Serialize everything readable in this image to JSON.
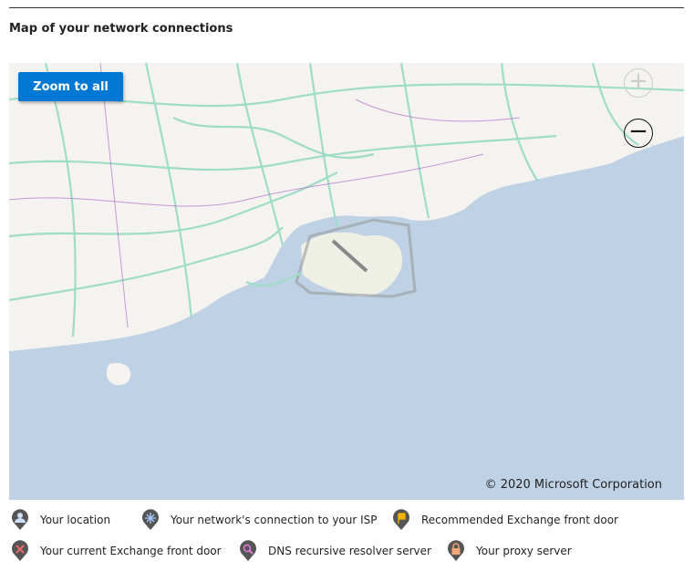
{
  "title": "Map of your network connections",
  "map": {
    "zoom_all_label": "Zoom to all",
    "zoom_in": "+",
    "zoom_out": "−",
    "copyright": "© 2020 Microsoft Corporation",
    "colors": {
      "sea": "#bfd1e5",
      "land": "#f5f3f0",
      "roads": "#9fdcc8",
      "accent": "#0078d4"
    }
  },
  "legend": [
    {
      "label": "Your location",
      "icon": "person-icon",
      "color": "#cfe0ff"
    },
    {
      "label": "Your network's connection to your ISP",
      "icon": "network-icon",
      "color": "#a9c8ff"
    },
    {
      "label": "Recommended Exchange front door",
      "icon": "flag-icon",
      "color": "#f2b600"
    },
    {
      "label": "Your current Exchange front door",
      "icon": "x-icon",
      "color": "#f06a6a"
    },
    {
      "label": "DNS recursive resolver server",
      "icon": "magnifier-icon",
      "color": "#e07ae0"
    },
    {
      "label": "Your proxy server",
      "icon": "lock-icon",
      "color": "#f0a878"
    }
  ]
}
